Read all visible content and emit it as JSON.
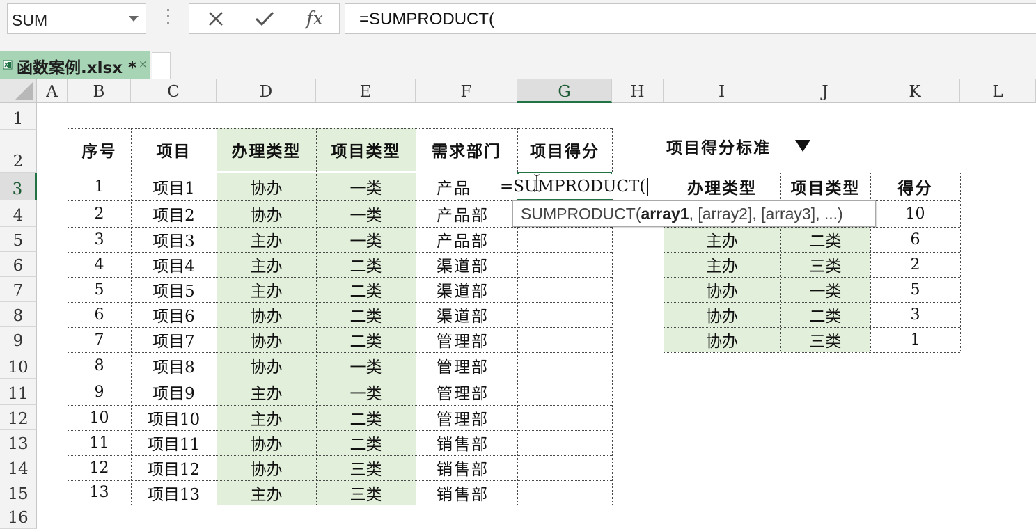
{
  "formula_bar": {
    "name_box": "SUM",
    "cancel_icon": "close-icon",
    "enter_icon": "check-icon",
    "fx_label": "fx",
    "formula": "=SUMPRODUCT("
  },
  "workbook_tab": {
    "name": "函数案例.xlsx *",
    "close": "×"
  },
  "columns": [
    "A",
    "B",
    "C",
    "D",
    "E",
    "F",
    "G",
    "H",
    "I",
    "J",
    "K",
    "L"
  ],
  "rows": [
    "1",
    "2",
    "3",
    "4",
    "5",
    "6",
    "7",
    "8",
    "9",
    "10",
    "11",
    "12",
    "13",
    "14",
    "15",
    "16"
  ],
  "main_table": {
    "headers": [
      "序号",
      "项目",
      "办理类型",
      "项目类型",
      "需求部门",
      "项目得分"
    ],
    "rows": [
      [
        "1",
        "项目1",
        "协办",
        "一类",
        "产品"
      ],
      [
        "2",
        "项目2",
        "协办",
        "一类",
        "产品部"
      ],
      [
        "3",
        "项目3",
        "主办",
        "一类",
        "产品部"
      ],
      [
        "4",
        "项目4",
        "主办",
        "二类",
        "渠道部"
      ],
      [
        "5",
        "项目5",
        "主办",
        "二类",
        "渠道部"
      ],
      [
        "6",
        "项目6",
        "协办",
        "二类",
        "渠道部"
      ],
      [
        "7",
        "项目7",
        "协办",
        "二类",
        "管理部"
      ],
      [
        "8",
        "项目8",
        "协办",
        "一类",
        "管理部"
      ],
      [
        "9",
        "项目9",
        "主办",
        "一类",
        "管理部"
      ],
      [
        "10",
        "项目10",
        "主办",
        "二类",
        "管理部"
      ],
      [
        "11",
        "项目11",
        "协办",
        "二类",
        "销售部"
      ],
      [
        "12",
        "项目12",
        "协办",
        "三类",
        "销售部"
      ],
      [
        "13",
        "项目13",
        "主办",
        "三类",
        "销售部"
      ]
    ]
  },
  "editing_cell": {
    "text": "=SUMPRODUCT("
  },
  "tooltip": {
    "func": "SUMPRODUCT(",
    "bold_arg": "array1",
    "rest": ", [array2], [array3], ...)"
  },
  "criteria_table": {
    "title": "项目得分标准",
    "title_icon": "triangle-down-icon",
    "headers": [
      "办理类型",
      "项目类型",
      "得分"
    ],
    "rows": [
      [
        "",
        "",
        "10"
      ],
      [
        "主办",
        "二类",
        "6"
      ],
      [
        "主办",
        "三类",
        "2"
      ],
      [
        "协办",
        "一类",
        "5"
      ],
      [
        "协办",
        "二类",
        "3"
      ],
      [
        "协办",
        "三类",
        "1"
      ]
    ]
  },
  "colors": {
    "accent": "#217346",
    "tab_green": "#a7d4b5",
    "cell_green": "#e2efda"
  }
}
